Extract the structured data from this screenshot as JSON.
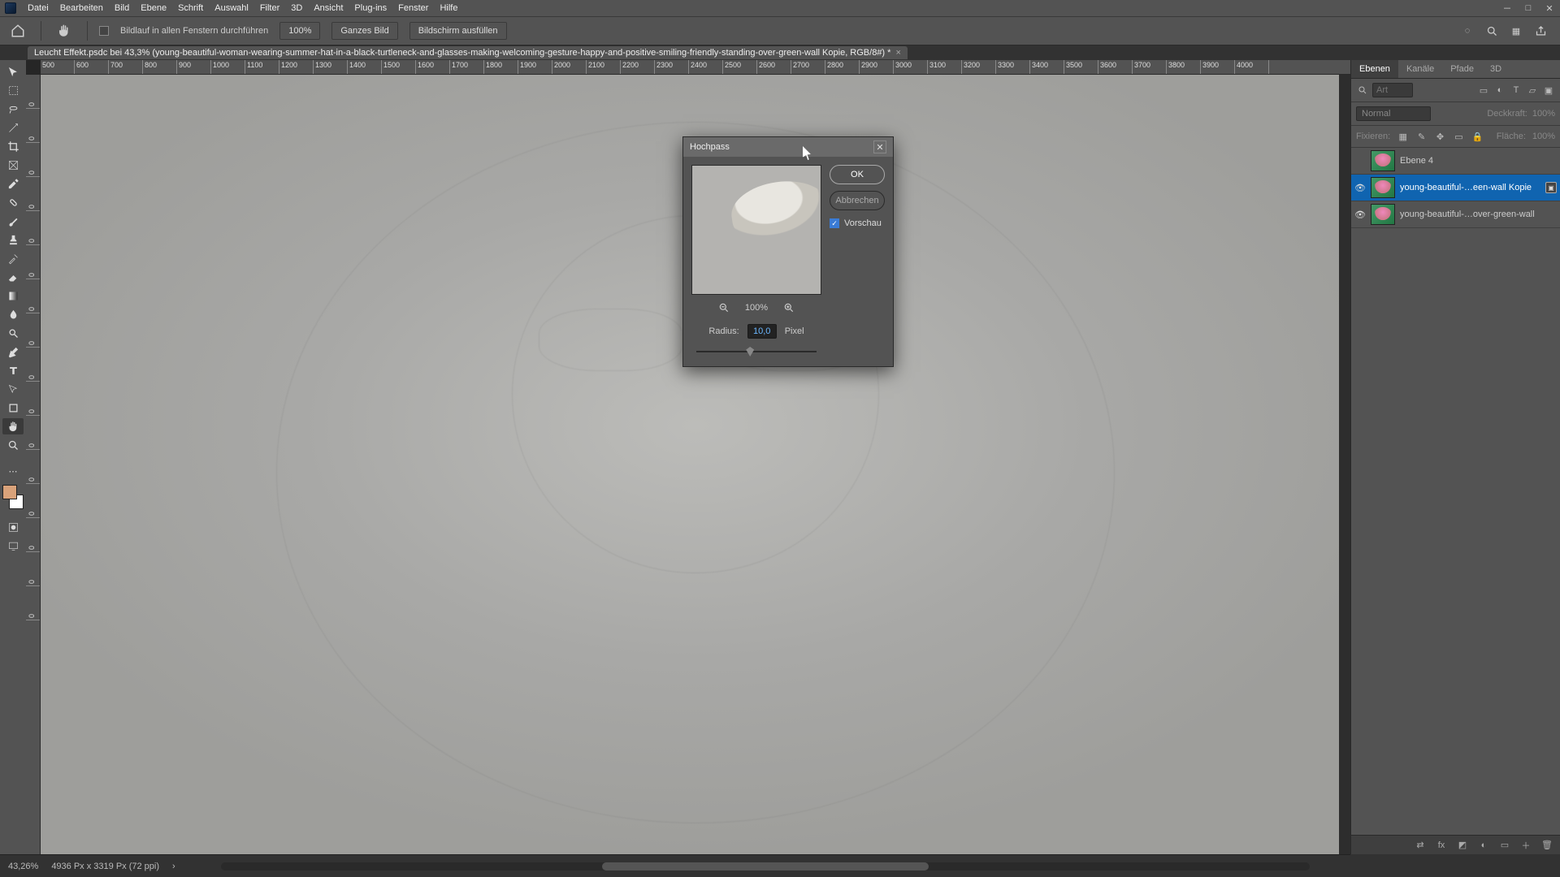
{
  "menu": {
    "items": [
      "Datei",
      "Bearbeiten",
      "Bild",
      "Ebene",
      "Schrift",
      "Auswahl",
      "Filter",
      "3D",
      "Ansicht",
      "Plug-ins",
      "Fenster",
      "Hilfe"
    ]
  },
  "options_bar": {
    "scroll_all_label": "Bildlauf in allen Fenstern durchführen",
    "zoom_display": "100%",
    "btn_whole": "Ganzes Bild",
    "btn_fit": "Bildschirm ausfüllen"
  },
  "document": {
    "tab_title": "Leucht Effekt.psdc bei 43,3% (young-beautiful-woman-wearing-summer-hat-in-a-black-turtleneck-and-glasses-making-welcoming-gesture-happy-and-positive-smiling-friendly-standing-over-green-wall Kopie, RGB/8#) *"
  },
  "ruler_ticks": [
    "500",
    "600",
    "700",
    "800",
    "900",
    "1000",
    "1100",
    "1200",
    "1300",
    "1400",
    "1500",
    "1600",
    "1700",
    "1800",
    "1900",
    "2000",
    "2100",
    "2200",
    "2300",
    "2400",
    "2500",
    "2600",
    "2700",
    "2800",
    "2900",
    "3000",
    "3100",
    "3200",
    "3300",
    "3400",
    "3500",
    "3600",
    "3700",
    "3800",
    "3900",
    "4000"
  ],
  "ruler_vticks": [
    "0",
    "0",
    "0",
    "0",
    "0",
    "0",
    "0",
    "0",
    "0",
    "0",
    "0",
    "0",
    "0",
    "0",
    "0",
    "0"
  ],
  "panels": {
    "tabs": [
      "Ebenen",
      "Kanäle",
      "Pfade",
      "3D"
    ],
    "search_placeholder": "Art",
    "blend_mode": "Normal",
    "opacity_label": "Deckkraft:",
    "opacity_value": "100%",
    "lock_label": "Fixieren:",
    "fill_label": "Fläche:",
    "fill_value": "100%",
    "layers": [
      {
        "visible": false,
        "name": "Ebene 4",
        "smart": false
      },
      {
        "visible": true,
        "name": "young-beautiful-…een-wall Kopie",
        "smart": true,
        "selected": true
      },
      {
        "visible": true,
        "name": "young-beautiful-…over-green-wall",
        "smart": false
      }
    ]
  },
  "dialog": {
    "title": "Hochpass",
    "ok": "OK",
    "cancel": "Abbrechen",
    "preview_label": "Vorschau",
    "preview_checked": true,
    "zoom_value": "100%",
    "radius_label": "Radius:",
    "radius_value": "10,0",
    "radius_unit": "Pixel"
  },
  "status": {
    "zoom": "43,26%",
    "info": "4936 Px x 3319 Px (72 ppi)"
  }
}
